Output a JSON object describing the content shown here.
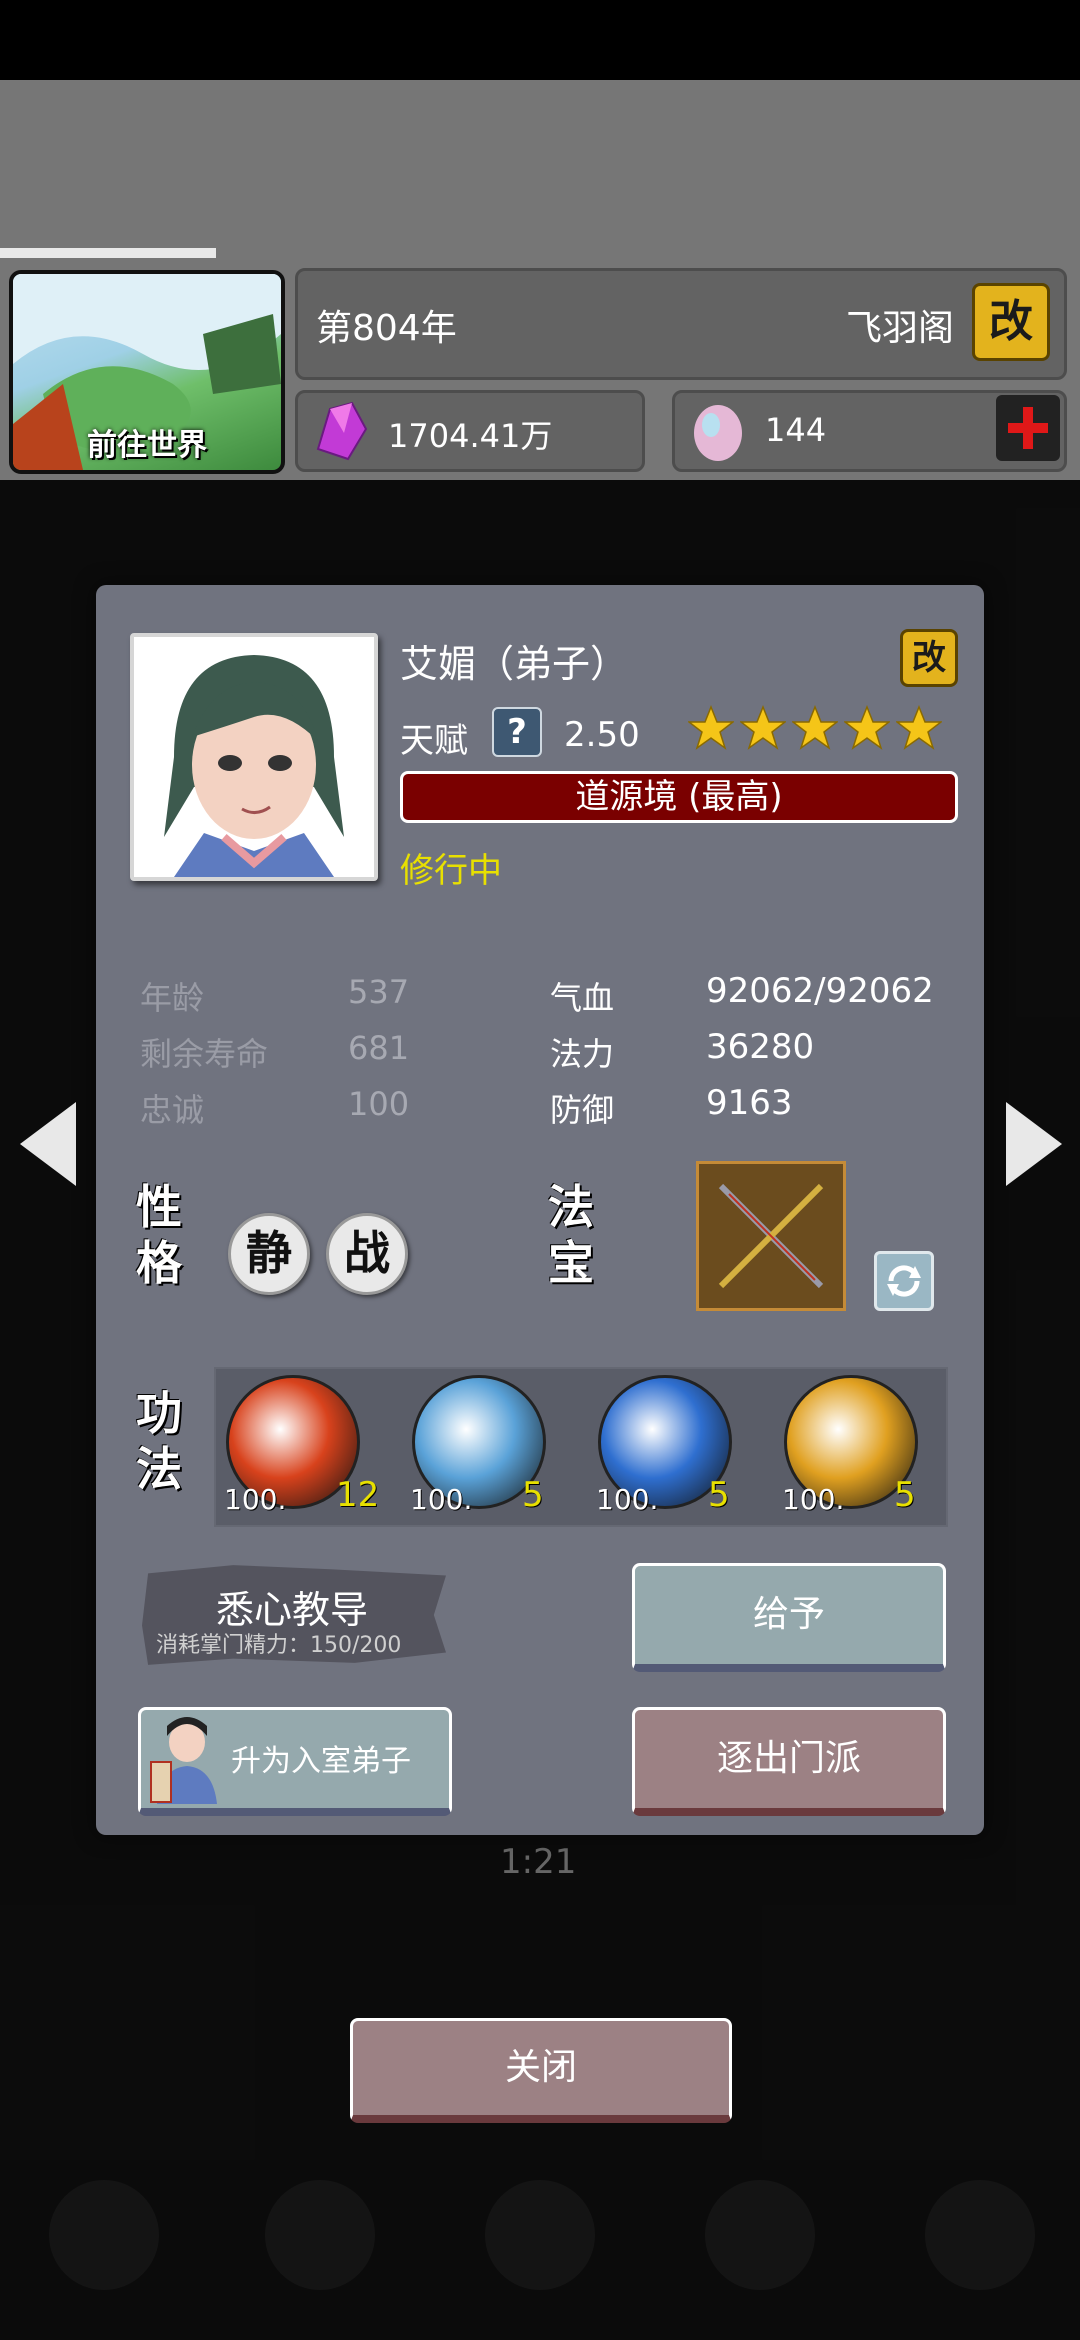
{
  "header": {
    "world_label": "前往世界",
    "year": "第804年",
    "sect_name": "飞羽阁",
    "rename_icon_text": "改",
    "spirit_stones": "1704.41万",
    "eggs": "144"
  },
  "background": {
    "timer": "1:21"
  },
  "modal": {
    "name": "艾媚（弟子）",
    "rename_icon_text": "改",
    "talent_label": "天赋",
    "talent_help": "?",
    "talent_value": "2.50",
    "stars": 5,
    "realm": "道源境 (最高)",
    "status": "修行中",
    "stats_left": [
      {
        "label": "年龄",
        "value": "537"
      },
      {
        "label": "剩余寿命",
        "value": "681"
      },
      {
        "label": "忠诚",
        "value": "100"
      }
    ],
    "stats_right": [
      {
        "label": "气血",
        "value": "92062/92062"
      },
      {
        "label": "法力",
        "value": "36280"
      },
      {
        "label": "防御",
        "value": "9163"
      }
    ],
    "personality_label_1": "性",
    "personality_label_2": "格",
    "traits": [
      "静",
      "战"
    ],
    "treasure_label_1": "法",
    "treasure_label_2": "宝",
    "skills_label_1": "功",
    "skills_label_2": "法",
    "skills": [
      {
        "pct": "100.",
        "level": "12",
        "color": "#d8421c"
      },
      {
        "pct": "100.",
        "level": "5",
        "color": "#5aa2d8"
      },
      {
        "pct": "100.",
        "level": "5",
        "color": "#2f6fd0"
      },
      {
        "pct": "100.",
        "level": "5",
        "color": "#e0a020"
      }
    ],
    "teach_label": "悉心教导",
    "teach_cost": "消耗掌门精力：150/200",
    "give_label": "给予",
    "promote_label": "升为入室弟子",
    "expel_label": "逐出门派"
  },
  "close_label": "关闭"
}
